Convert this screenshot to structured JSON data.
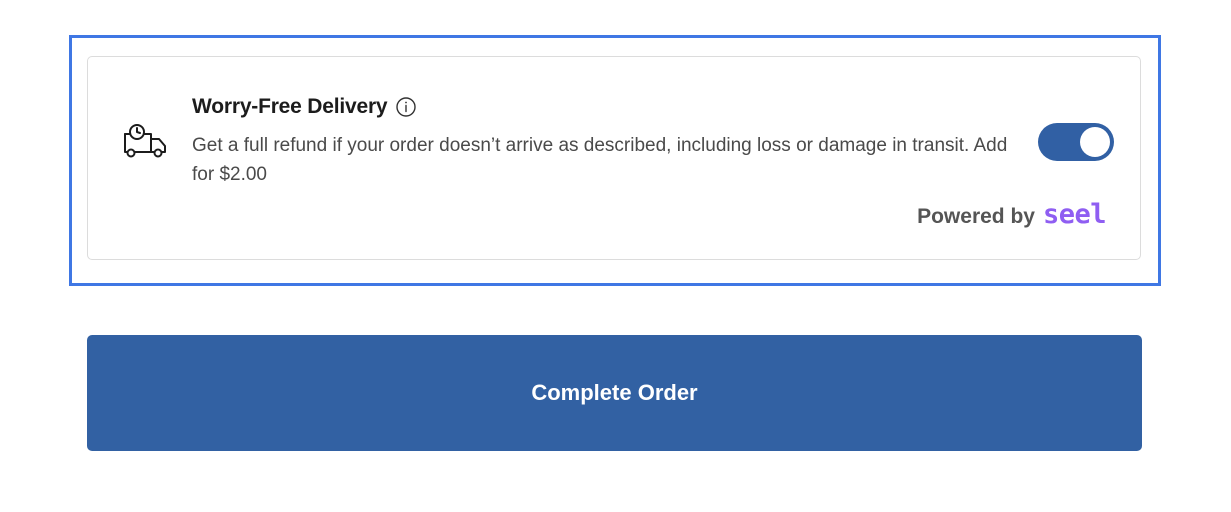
{
  "protection_card": {
    "title": "Worry-Free Delivery",
    "description": "Get a full refund if your order doesn’t arrive as described, including loss or damage in transit. Add for $2.00",
    "toggle_on": true,
    "powered_by_label": "Powered by",
    "brand_name": "seel",
    "icons": {
      "delivery": "truck-clock-icon",
      "info": "info-icon"
    }
  },
  "checkout": {
    "complete_label": "Complete Order"
  },
  "colors": {
    "highlight_border": "#3f77e4",
    "primary": "#3261a3",
    "brand": "#8f5ef2"
  }
}
